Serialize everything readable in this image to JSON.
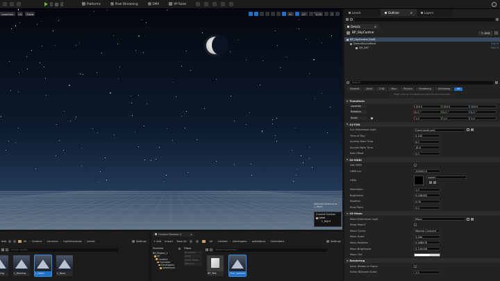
{
  "toolbar": {
    "items": [
      {
        "label": "Platforms",
        "icon": "platforms-icon"
      },
      {
        "label": "Pixel Streaming",
        "icon": "pixel-streaming-icon"
      },
      {
        "label": "DMX",
        "icon": "dmx-icon"
      },
      {
        "label": "VP Rules",
        "icon": "vp-rules-icon"
      }
    ]
  },
  "viewport": {
    "menu": [
      "rspective",
      "Lit",
      "Show"
    ],
    "fov": "90",
    "snap_angle": "10°",
    "scale_snap": "0.25",
    "camera_speed": "1",
    "selected_actors": "Selected Actor(s) in:",
    "selected_level": "L_Night",
    "current_outliner": "Current Outliner",
    "level_label": "Level",
    "level_value": "L_Night"
  },
  "outliner_tabs": [
    "Levels",
    "Outliner",
    "Layers"
  ],
  "details": {
    "tab": "Details",
    "actor_name": "BP_SkyControl",
    "add_label": "+ Add",
    "components": [
      {
        "name": "BP_SkyControl (Self)",
        "edit": ""
      },
      {
        "name": "DefaultSceneRoot",
        "edit": "Edit in"
      },
      {
        "name": "SM_SKY",
        "edit": "Edit in"
      }
    ],
    "search_placeholder": "Search",
    "filter_tabs": [
      "General",
      "Actor",
      "LOD",
      "Misc",
      "Physics",
      "Rendering",
      "Streaming",
      "All"
    ],
    "hint": "Right-click on a property to add it to your Favorites",
    "transform": {
      "title": "Transform",
      "rows": [
        {
          "label": "Location",
          "values": [
            "100.0",
            "100.0",
            "100.0"
          ]
        },
        {
          "label": "Rotation",
          "values": [
            "0.0 °",
            "0.0 °",
            "0.0 °"
          ]
        },
        {
          "label": "Scale",
          "values": [
            "1.0",
            "1.0",
            "1.0"
          ]
        }
      ]
    },
    "tod": {
      "title": "01-TOD",
      "rows": [
        {
          "label": "Sun Directional Light",
          "value": "DirectionalLight"
        },
        {
          "label": "Time of Day",
          "value": "0.100"
        },
        {
          "label": "Sunrise Start Time",
          "value": "6.0"
        },
        {
          "label": "Sunset State Time",
          "value": "18.0"
        },
        {
          "label": "East Offset",
          "value": "0.0"
        }
      ]
    },
    "hdri": {
      "title": "02-HDRI",
      "rows": [
        {
          "label": "Use HDRI",
          "value": ""
        },
        {
          "label": "HDRI Lux",
          "value": "100000.0"
        },
        {
          "label": "HDRI",
          "value": "night1"
        },
        {
          "label": "Saturation",
          "value": "1.0"
        },
        {
          "label": "Brightness",
          "value": "0.008462"
        },
        {
          "label": "Rotation",
          "value": "0.00"
        },
        {
          "label": "Pivot Point",
          "value": "0.0"
        }
      ]
    },
    "moon": {
      "title": "03-Moon",
      "rows": [
        {
          "label": "Moon Directional Light",
          "value": "Moon"
        },
        {
          "label": "Show Moon?",
          "value": ""
        },
        {
          "label": "Moon Cycles",
          "value": "Waxing Crescent"
        },
        {
          "label": "Moon Scale",
          "value": "3.284"
        },
        {
          "label": "Moon Rotation",
          "value": "0.468878"
        },
        {
          "label": "Moon Brightness",
          "value": "0.190008"
        },
        {
          "label": "Moon Tint",
          "value": ""
        }
      ]
    },
    "rendering": {
      "title": "Rendering",
      "rows": [
        {
          "label": "Actor Hidden In Game",
          "value": ""
        },
        {
          "label": "Editor Billboard Scale",
          "value": "1.0"
        }
      ]
    }
  },
  "content_browser_left": {
    "add_label": "Add",
    "path": [
      "All",
      "Content",
      "Common",
      "LightScenarios",
      "Levels"
    ],
    "settings": "Settings",
    "search_placeholder": "Search Levels",
    "items": [
      "L_Evening",
      "L_Morning",
      "L_Night",
      "L_Noon"
    ]
  },
  "content_browser_2": {
    "tab": "Content Browser 2",
    "add_label": "+ Add",
    "import_label": "Import",
    "save_all_label": "Save All",
    "path": [
      "All",
      "Content",
      "Developers",
      "pakeetpuri",
      "Collections"
    ],
    "settings": "Settings",
    "favorites": "Favorites",
    "project_root": "BS_Project_1",
    "tree": [
      "All",
      "Content",
      "Common",
      "Developers",
      "pakeetpuri"
    ],
    "filters_label": "Filters",
    "filters": [
      "Blueprint",
      "Level",
      "Static Mesh",
      "Material"
    ],
    "search_placeholder": "Search Collections",
    "items": [
      "BP_Test",
      "Test_Updates"
    ]
  },
  "colors": {
    "accent": "#1e72c8",
    "play": "#6db33f",
    "header": "#1f1f1f",
    "panel": "#242424"
  }
}
